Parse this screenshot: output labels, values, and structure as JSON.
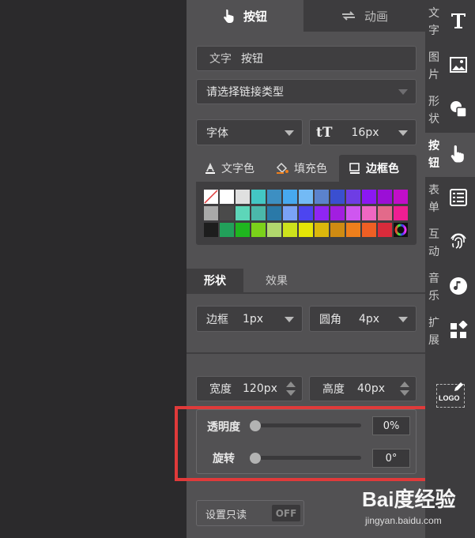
{
  "top_tabs": {
    "button": "按钮",
    "animation": "动画"
  },
  "text_field": {
    "label": "文字",
    "value": "按钮"
  },
  "link_type": {
    "placeholder": "请选择链接类型"
  },
  "font": {
    "family": "字体",
    "size": "16px"
  },
  "color_tabs": {
    "text_color": "文字色",
    "fill_color": "填充色",
    "border_color": "边框色"
  },
  "palette": {
    "rows": [
      [
        "none",
        "#ffffff",
        "#e0e0e0",
        "#43c7c4",
        "#3d8fc2",
        "#47a9ef",
        "#73baf5",
        "#5b82cc",
        "#3a4fd0",
        "#6e3de4",
        "#8b18f2",
        "#9b0fd6",
        "#c10ec9"
      ],
      [
        "#a9a9a9",
        "#4a4a4a",
        "#5dd6b9",
        "#4bb8aa",
        "#2a79a8",
        "#7aa2f5",
        "#4c45f0",
        "#8f25f3",
        "#a21ee0",
        "#cf56f0",
        "#ef67c2",
        "#e36a8a",
        "#ee1e93"
      ],
      [
        "#1d1d1d",
        "#22a05a",
        "#1fb61f",
        "#7bd11a",
        "#b1d76d",
        "#cde31c",
        "#e5e507",
        "#dbb70c",
        "#cf8b12",
        "#ee7f1c",
        "#ef5f24",
        "#d92b3b",
        "multicolor"
      ]
    ]
  },
  "sub_tabs": {
    "shape": "形状",
    "effect": "效果"
  },
  "border": {
    "label": "边框",
    "value": "1px"
  },
  "radius": {
    "label": "圆角",
    "value": "4px"
  },
  "width": {
    "label": "宽度",
    "value": "120px"
  },
  "height": {
    "label": "高度",
    "value": "40px"
  },
  "opacity": {
    "label": "透明度",
    "value": "0%",
    "level": 0
  },
  "rotation": {
    "label": "旋转",
    "value": "0°",
    "level": 0
  },
  "readonly": {
    "label": "设置只读",
    "toggle": "OFF"
  },
  "rail": {
    "items": [
      {
        "label": "文字",
        "icon": "text-icon"
      },
      {
        "label": "图片",
        "icon": "image-icon"
      },
      {
        "label": "形状",
        "icon": "shape-icon"
      },
      {
        "label": "按钮",
        "icon": "pointer-hand-icon"
      },
      {
        "label": "表单",
        "icon": "form-list-icon"
      },
      {
        "label": "互动",
        "icon": "fingerprint-icon"
      },
      {
        "label": "音乐",
        "icon": "music-icon"
      },
      {
        "label": "扩展",
        "icon": "extension-icon"
      }
    ],
    "logo_label": "LOGO"
  },
  "watermark": {
    "main": "Bai度经验",
    "sub": "jingyan.baidu.com"
  },
  "colors": {
    "panel": "#525153",
    "rail": "#3d3c3e",
    "highlight": "#e03a3a"
  }
}
